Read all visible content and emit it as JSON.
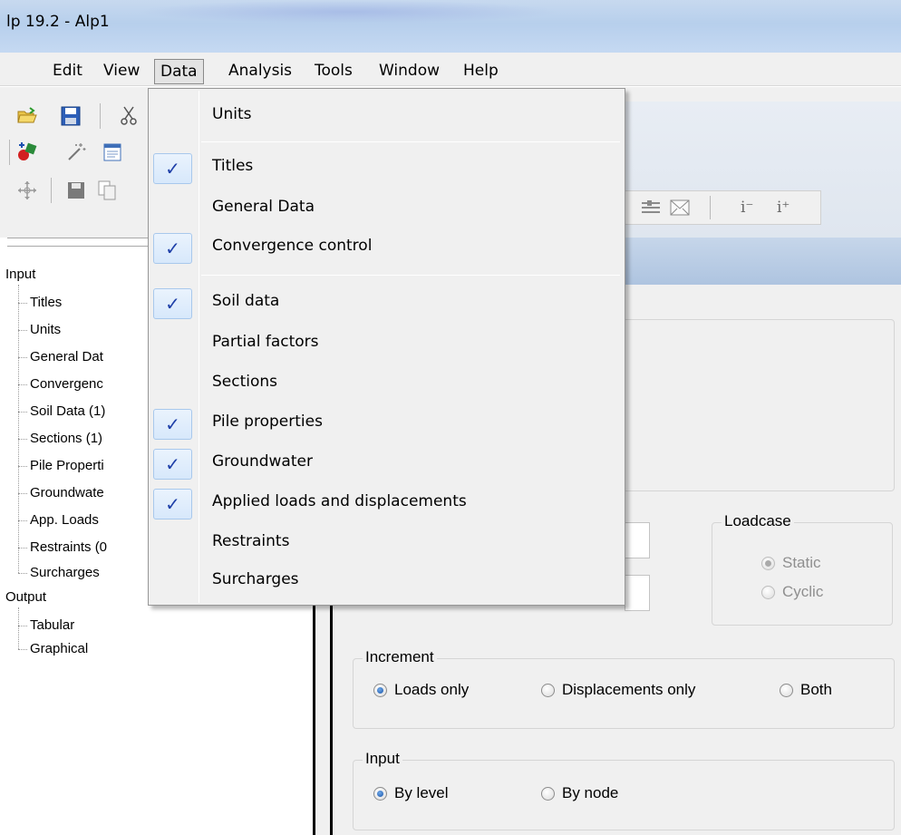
{
  "window": {
    "title": "lp 19.2 - Alp1"
  },
  "menubar": {
    "items": [
      {
        "label": "Edit"
      },
      {
        "label": "View"
      },
      {
        "label": "Data",
        "active": true
      },
      {
        "label": "Analysis"
      },
      {
        "label": "Tools"
      },
      {
        "label": "Window"
      },
      {
        "label": "Help"
      }
    ]
  },
  "toolbar": {
    "icons": [
      "open-folder-icon",
      "save-icon",
      "cut-icon",
      "add-shape-icon",
      "wand-icon",
      "window-icon",
      "move-icon",
      "save-small-icon",
      "copy-icon",
      "grid-icon",
      "envelope-icon"
    ],
    "i_minus": "i⁻",
    "i_plus": "i⁺"
  },
  "data_menu": {
    "items": [
      {
        "label": "Units",
        "checked": false
      },
      {
        "label": "Titles",
        "checked": true
      },
      {
        "label": "General Data",
        "checked": false
      },
      {
        "label": "Convergence control",
        "checked": true
      },
      {
        "label": "Soil data",
        "checked": true
      },
      {
        "label": "Partial factors",
        "checked": false
      },
      {
        "label": "Sections",
        "checked": false
      },
      {
        "label": "Pile properties",
        "checked": true
      },
      {
        "label": "Groundwater",
        "checked": true
      },
      {
        "label": "Applied loads and displacements",
        "checked": true
      },
      {
        "label": "Restraints",
        "checked": false
      },
      {
        "label": "Surcharges",
        "checked": false
      }
    ],
    "check_glyph": "✓"
  },
  "tree": {
    "input_label": "Input",
    "input_children": [
      "Titles",
      "Units",
      "General Dat",
      "Convergenc",
      "Soil Data (1)",
      "Sections (1)",
      "Pile Properti",
      "Groundwate",
      "App. Loads",
      "Restraints (0",
      "Surcharges"
    ],
    "output_label": "Output",
    "output_children": [
      "Tabular",
      "Graphical"
    ]
  },
  "loadcase": {
    "title": "Loadcase",
    "options": [
      {
        "label": "Static",
        "selected": true
      },
      {
        "label": "Cyclic",
        "selected": false
      }
    ]
  },
  "increment": {
    "title": "Increment",
    "options": [
      {
        "label": "Loads only",
        "selected": true
      },
      {
        "label": "Displacements only",
        "selected": false
      },
      {
        "label": "Both",
        "selected": false
      }
    ]
  },
  "input_group": {
    "title": "Input",
    "options": [
      {
        "label": "By level",
        "selected": true
      },
      {
        "label": "By node",
        "selected": false
      }
    ]
  },
  "colors": {
    "accent": "#1a55a8",
    "check": "#1e3fa8",
    "titlebar": "#bcd2ee"
  }
}
